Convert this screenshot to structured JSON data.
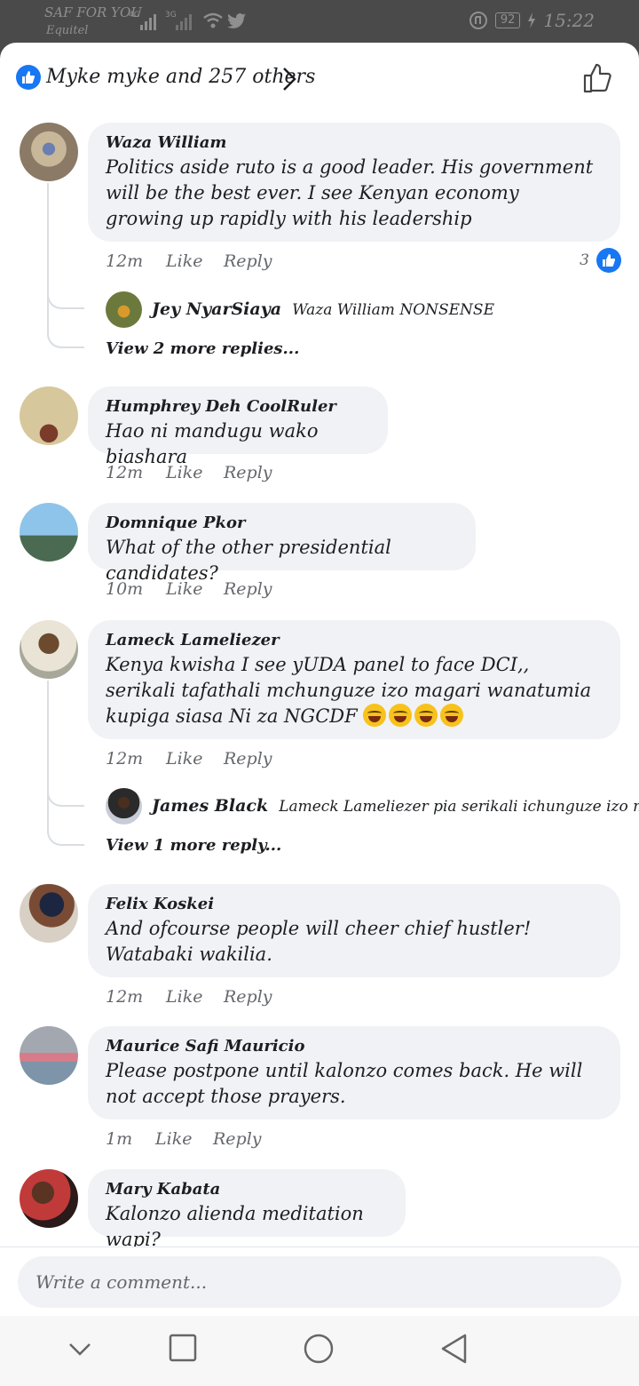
{
  "status_bar": {
    "carrier": "SAF FOR YOU",
    "carrier_sub": "Equitel",
    "net1": "4G",
    "net2": "3G",
    "battery": "92",
    "time": "15:22"
  },
  "reactions": {
    "summary": "Myke myke and 257 others"
  },
  "comments": [
    {
      "author": "Waza William",
      "text": "Politics aside ruto is a good leader. His government will be the best ever. I see Kenyan economy growing up rapidly with his leadership",
      "time": "12m",
      "like": "Like",
      "reply": "Reply",
      "reaction_count": "3",
      "reply_preview": {
        "author": "Jey NyarSiaya",
        "text": "Waza William NONSENSE"
      },
      "more_replies": "View 2 more replies..."
    },
    {
      "author": "Humphrey Deh CoolRuler",
      "text": "Hao ni mandugu wako biashara",
      "time": "12m",
      "like": "Like",
      "reply": "Reply"
    },
    {
      "author": "Domnique Pkor",
      "text": "What of the other presidential candidates?",
      "time": "10m",
      "like": "Like",
      "reply": "Reply"
    },
    {
      "author": "Lameck Lameliezer",
      "text": "Kenya kwisha I see yUDA panel to face DCI,, serikali tafathali mchunguze izo magari wanatumia kupiga siasa Ni za NGCDF",
      "emoji_count": 4,
      "time": "12m",
      "like": "Like",
      "reply": "Reply",
      "reply_preview": {
        "author": "James Black",
        "text": "Lameck Lameliezer pia serikali ichunguze izo machoppe..."
      },
      "more_replies": "View 1 more reply..."
    },
    {
      "author": "Felix Koskei",
      "text": "And ofcourse people will cheer chief hustler! Watabaki wakilia.",
      "time": "12m",
      "like": "Like",
      "reply": "Reply"
    },
    {
      "author": "Maurice Safi Mauricio",
      "text": "Please postpone until kalonzo comes back. He will not accept those prayers.",
      "time": "1m",
      "like": "Like",
      "reply": "Reply"
    },
    {
      "author": "Mary Kabata",
      "text": "Kalonzo alienda meditation wapi?"
    }
  ],
  "composer": {
    "placeholder": "Write a comment..."
  },
  "icons": {
    "like_badge": "like-thumb-icon",
    "chevron": "chevron-right-icon",
    "like_outline": "thumbs-up-outline-icon",
    "nav_back": "back-triangle-icon",
    "nav_home": "home-circle-icon",
    "nav_recents": "recents-square-icon",
    "nav_down": "chevron-down-icon"
  },
  "colors": {
    "accent": "#1877f2",
    "bubble": "#f0f2f5",
    "meta": "#65676b"
  }
}
